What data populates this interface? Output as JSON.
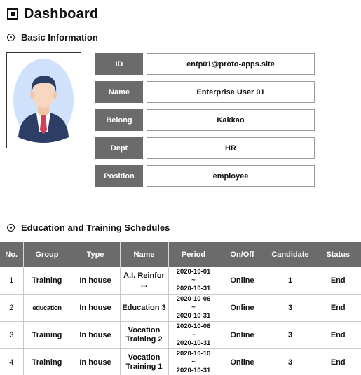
{
  "header": {
    "title": "Dashboard"
  },
  "basic_info": {
    "section_title": "Basic Information",
    "fields": [
      {
        "label": "ID",
        "value": "entp01@proto-apps.site"
      },
      {
        "label": "Name",
        "value": "Enterprise User 01"
      },
      {
        "label": "Belong",
        "value": "Kakkao"
      },
      {
        "label": "Dept",
        "value": "HR"
      },
      {
        "label": "Position",
        "value": "employee"
      }
    ],
    "avatar_icon": "user-avatar-icon"
  },
  "schedules": {
    "section_title": "Education and Training Schedules",
    "columns": [
      "No.",
      "Group",
      "Type",
      "Name",
      "Period",
      "On/Off",
      "Candidate",
      "Status"
    ],
    "rows": [
      {
        "no": "1",
        "group": "Training",
        "type": "In house",
        "name": "A.I. Reinfor ...",
        "start": "2020-10-01",
        "sep": "~",
        "end": "2020-10-31",
        "onoff": "Online",
        "candidate": "1",
        "status": "End"
      },
      {
        "no": "2",
        "group": "education",
        "type": "In house",
        "name": "Education 3",
        "start": "2020-10-06",
        "sep": "~",
        "end": "2020-10-31",
        "onoff": "Online",
        "candidate": "3",
        "status": "End"
      },
      {
        "no": "3",
        "group": "Training",
        "type": "In house",
        "name": "Vocation Training 2",
        "start": "2020-10-06",
        "sep": "~",
        "end": "2020-10-31",
        "onoff": "Online",
        "candidate": "3",
        "status": "End"
      },
      {
        "no": "4",
        "group": "Training",
        "type": "In house",
        "name": "Vocation Training 1",
        "start": "2020-10-10",
        "sep": "~",
        "end": "2020-10-31",
        "onoff": "Online",
        "candidate": "3",
        "status": "End"
      }
    ]
  },
  "colors": {
    "label_bg": "#6b6b6b",
    "avatar_bg": "#cfe1fb",
    "suit": "#2c3e66",
    "tie": "#d0415a"
  }
}
